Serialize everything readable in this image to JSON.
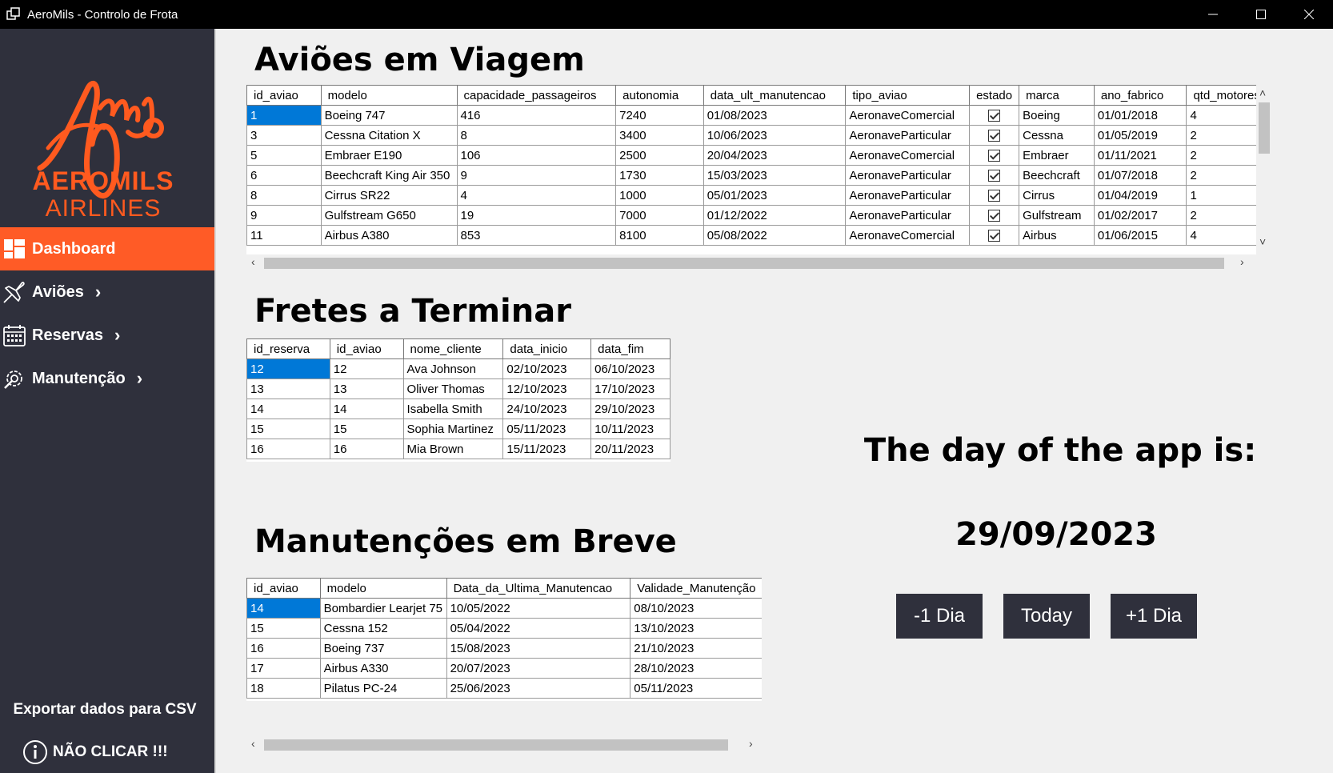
{
  "window": {
    "title": "AeroMils - Controlo de Frota"
  },
  "sidebar": {
    "logo_line1": "AEROMILS",
    "logo_line2": "AIRLINES",
    "items": [
      {
        "label": "Dashboard",
        "icon": "dashboard-icon"
      },
      {
        "label": "Aviões",
        "icon": "airplane-icon"
      },
      {
        "label": "Reservas",
        "icon": "calendar-icon"
      },
      {
        "label": "Manutenção",
        "icon": "wrench-gear-icon"
      }
    ],
    "export_label": "Exportar dados para CSV",
    "noclick_label": "NÃO CLICAR !!!"
  },
  "colors": {
    "accent": "#ff5b26",
    "sidebar": "#2f303c",
    "selection": "#0078d7"
  },
  "avioes": {
    "title": "Aviões em Viagem",
    "columns": [
      "id_aviao",
      "modelo",
      "capacidade_passageiros",
      "autonomia",
      "data_ult_manutencao",
      "tipo_aviao",
      "estado",
      "marca",
      "ano_fabrico",
      "qtd_motores"
    ],
    "rows": [
      [
        "1",
        "Boeing 747",
        "416",
        "7240",
        "01/08/2023",
        "AeronaveComercial",
        "true",
        "Boeing",
        "01/01/2018",
        "4"
      ],
      [
        "3",
        "Cessna Citation X",
        "8",
        "3400",
        "10/06/2023",
        "AeronaveParticular",
        "true",
        "Cessna",
        "01/05/2019",
        "2"
      ],
      [
        "5",
        "Embraer E190",
        "106",
        "2500",
        "20/04/2023",
        "AeronaveComercial",
        "true",
        "Embraer",
        "01/11/2021",
        "2"
      ],
      [
        "6",
        "Beechcraft King Air 350",
        "9",
        "1730",
        "15/03/2023",
        "AeronaveParticular",
        "true",
        "Beechcraft",
        "01/07/2018",
        "2"
      ],
      [
        "8",
        "Cirrus SR22",
        "4",
        "1000",
        "05/01/2023",
        "AeronaveParticular",
        "true",
        "Cirrus",
        "01/04/2019",
        "1"
      ],
      [
        "9",
        "Gulfstream G650",
        "19",
        "7000",
        "01/12/2022",
        "AeronaveParticular",
        "true",
        "Gulfstream",
        "01/02/2017",
        "2"
      ],
      [
        "11",
        "Airbus A380",
        "853",
        "8100",
        "05/08/2022",
        "AeronaveComercial",
        "true",
        "Airbus",
        "01/06/2015",
        "4"
      ]
    ]
  },
  "fretes": {
    "title": "Fretes a Terminar",
    "columns": [
      "id_reserva",
      "id_aviao",
      "nome_cliente",
      "data_inicio",
      "data_fim"
    ],
    "rows": [
      [
        "12",
        "12",
        "Ava Johnson",
        "02/10/2023",
        "06/10/2023"
      ],
      [
        "13",
        "13",
        "Oliver Thomas",
        "12/10/2023",
        "17/10/2023"
      ],
      [
        "14",
        "14",
        "Isabella Smith",
        "24/10/2023",
        "29/10/2023"
      ],
      [
        "15",
        "15",
        "Sophia Martinez",
        "05/11/2023",
        "10/11/2023"
      ],
      [
        "16",
        "16",
        "Mia Brown",
        "15/11/2023",
        "20/11/2023"
      ]
    ]
  },
  "manutencoes": {
    "title": "Manutenções em Breve",
    "columns": [
      "id_aviao",
      "modelo",
      "Data_da_Ultima_Manutencao",
      "Validade_Manutenção"
    ],
    "rows": [
      [
        "14",
        "Bombardier Learjet 75",
        "10/05/2022",
        "08/10/2023"
      ],
      [
        "15",
        "Cessna 152",
        "05/04/2022",
        "13/10/2023"
      ],
      [
        "16",
        "Boeing 737",
        "15/08/2023",
        "21/10/2023"
      ],
      [
        "17",
        "Airbus A330",
        "20/07/2023",
        "28/10/2023"
      ],
      [
        "18",
        "Pilatus PC-24",
        "25/06/2023",
        "05/11/2023"
      ]
    ]
  },
  "day": {
    "label": "The day of the app is:",
    "value": "29/09/2023",
    "buttons": {
      "minus": "-1 Dia",
      "today": "Today",
      "plus": "+1 Dia"
    }
  }
}
